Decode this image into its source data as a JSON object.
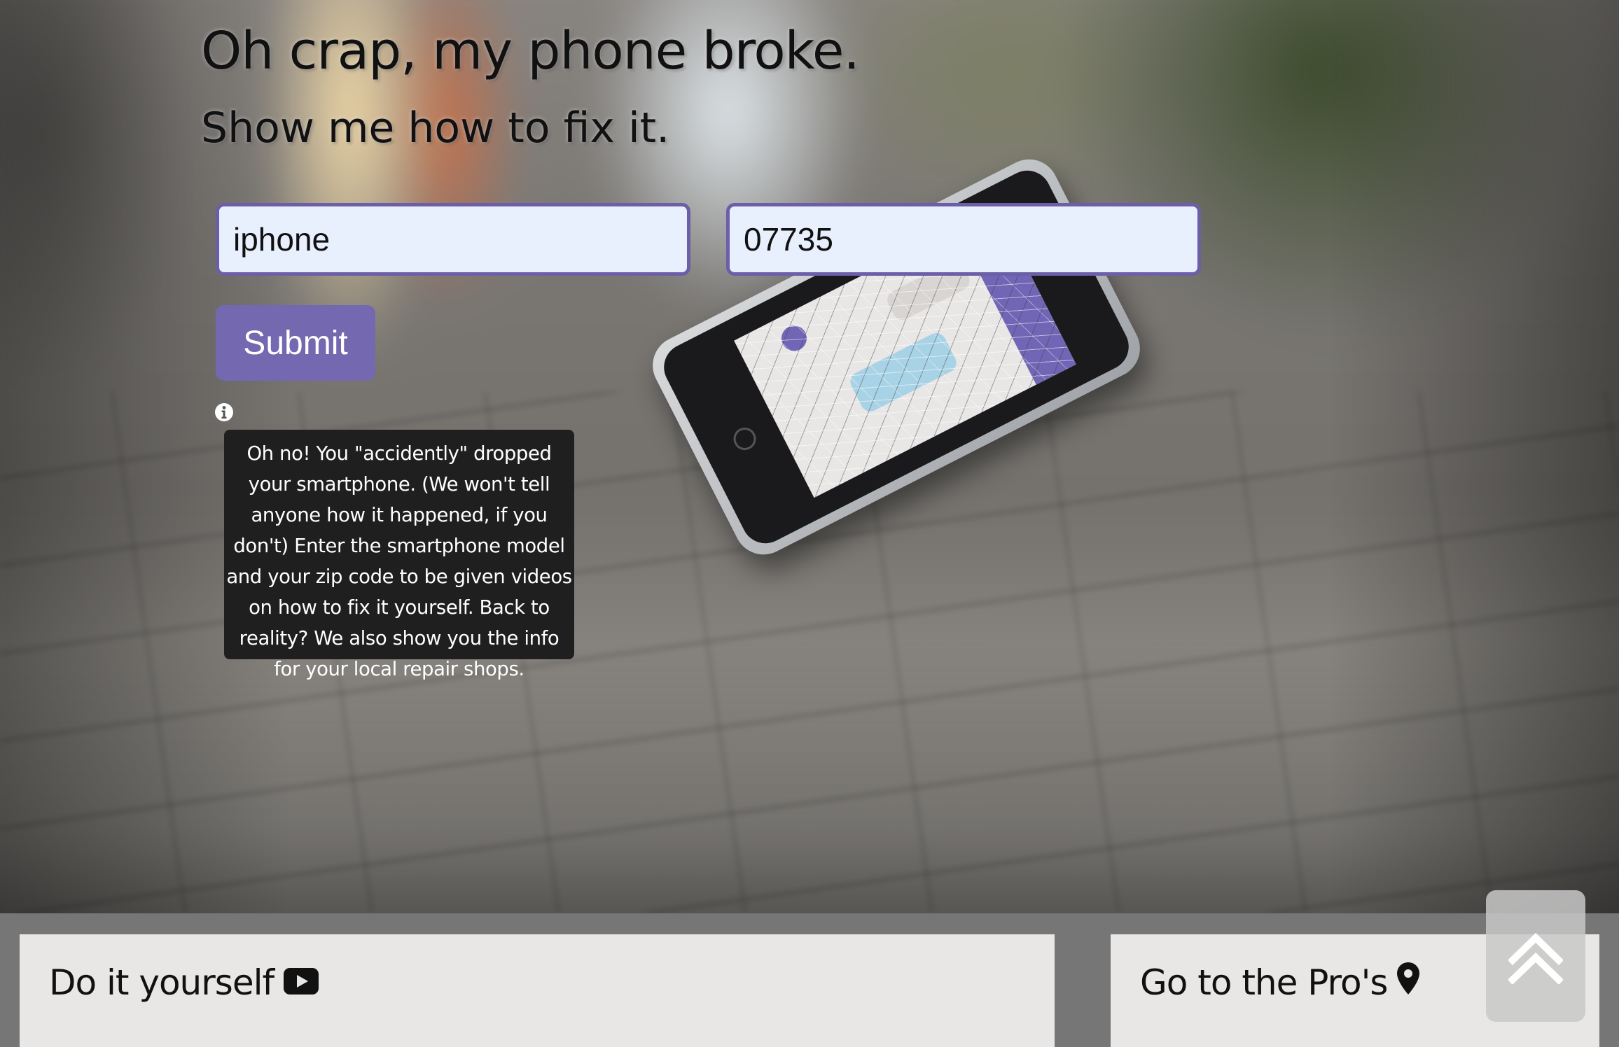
{
  "hero": {
    "title": "Oh crap, my phone broke.",
    "subtitle": "Show me how to fix it."
  },
  "form": {
    "model_value": "iphone",
    "zip_value": "07735",
    "submit_label": "Submit"
  },
  "info": {
    "icon": "info-circle-icon",
    "tooltip": "Oh no! You \"accidently\" dropped your smartphone. (We won't tell anyone how it happened, if you don't) Enter the smartphone model and your zip code to be given videos on how to fix it yourself. Back to reality? We also show you the info for your local repair shops."
  },
  "panels": {
    "diy_title": "Do it yourself",
    "diy_icon": "youtube-icon",
    "pros_title": "Go to the Pro's",
    "pros_icon": "map-marker-icon"
  },
  "scroll_top": {
    "icon": "double-chevron-up-icon"
  },
  "colors": {
    "accent": "#7468b0",
    "input_border": "#6c5fa8",
    "input_bg": "#e8effd",
    "tooltip_bg": "#1f1f1f",
    "panel_bg": "#e8e7e5"
  }
}
